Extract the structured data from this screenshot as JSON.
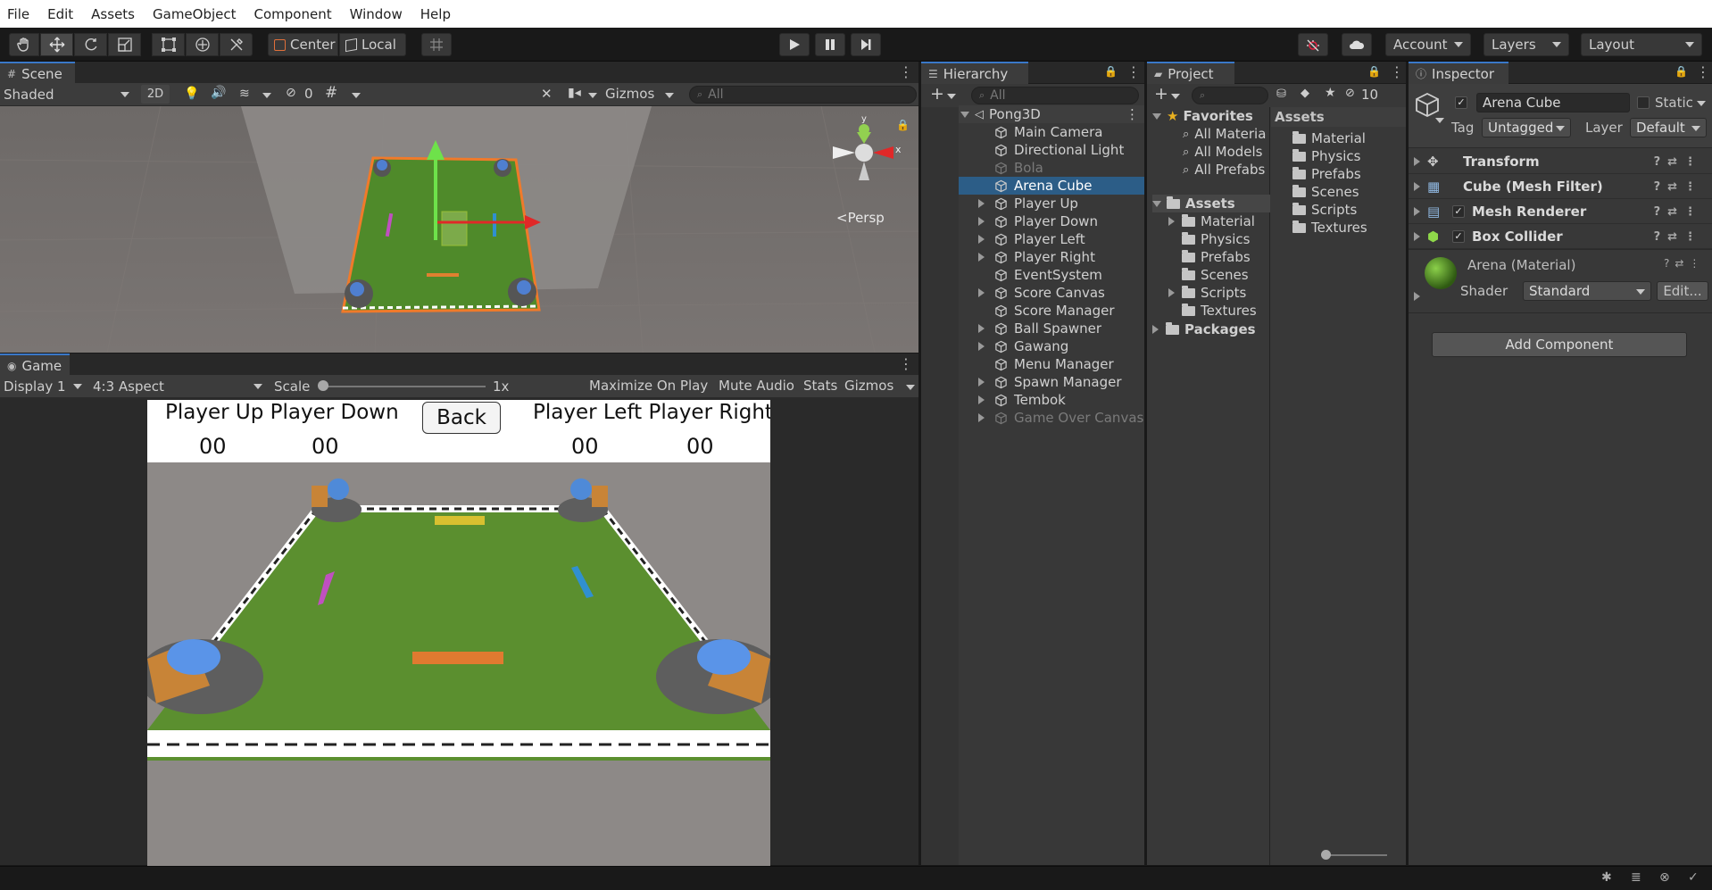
{
  "menubar": [
    "File",
    "Edit",
    "Assets",
    "GameObject",
    "Component",
    "Window",
    "Help"
  ],
  "toolbar": {
    "center_label": "Center",
    "local_label": "Local",
    "account_label": "Account",
    "layers_label": "Layers",
    "layout_label": "Layout"
  },
  "scene": {
    "tab_label": "Scene",
    "shading_mode": "Shaded",
    "btn_2d": "2D",
    "hidden_count": "0",
    "gizmos_label": "Gizmos",
    "search_placeholder": "All",
    "persp_label": "<Persp",
    "axis_y": "y",
    "axis_x": "x"
  },
  "game": {
    "tab_label": "Game",
    "display_label": "Display 1",
    "aspect_label": "4:3 Aspect",
    "scale_label": "Scale",
    "scale_value": "1x",
    "maximize_label": "Maximize On Play",
    "mute_label": "Mute Audio",
    "stats_label": "Stats",
    "gizmos_label": "Gizmos",
    "hud": {
      "player_up_down": "Player Up Player Down",
      "back_button": "Back",
      "player_left_right": "Player Left Player Right",
      "score_up": "00",
      "score_down": "00",
      "score_left": "00",
      "score_right": "00"
    }
  },
  "hierarchy": {
    "tab_label": "Hierarchy",
    "search_placeholder": "All",
    "scene_name": "Pong3D",
    "items": [
      {
        "label": "Main Camera",
        "expandable": false,
        "disabled": false,
        "selected": false
      },
      {
        "label": "Directional Light",
        "expandable": false,
        "disabled": false,
        "selected": false
      },
      {
        "label": "Bola",
        "expandable": false,
        "disabled": true,
        "selected": false
      },
      {
        "label": "Arena Cube",
        "expandable": false,
        "disabled": false,
        "selected": true
      },
      {
        "label": "Player Up",
        "expandable": true,
        "disabled": false,
        "selected": false
      },
      {
        "label": "Player Down",
        "expandable": true,
        "disabled": false,
        "selected": false
      },
      {
        "label": "Player Left",
        "expandable": true,
        "disabled": false,
        "selected": false
      },
      {
        "label": "Player Right",
        "expandable": true,
        "disabled": false,
        "selected": false
      },
      {
        "label": "EventSystem",
        "expandable": false,
        "disabled": false,
        "selected": false
      },
      {
        "label": "Score Canvas",
        "expandable": true,
        "disabled": false,
        "selected": false
      },
      {
        "label": "Score Manager",
        "expandable": false,
        "disabled": false,
        "selected": false
      },
      {
        "label": "Ball Spawner",
        "expandable": true,
        "disabled": false,
        "selected": false
      },
      {
        "label": "Gawang",
        "expandable": true,
        "disabled": false,
        "selected": false
      },
      {
        "label": "Menu Manager",
        "expandable": false,
        "disabled": false,
        "selected": false
      },
      {
        "label": "Spawn Manager",
        "expandable": true,
        "disabled": false,
        "selected": false
      },
      {
        "label": "Tembok",
        "expandable": true,
        "disabled": false,
        "selected": false
      },
      {
        "label": "Game Over Canvas",
        "expandable": true,
        "disabled": true,
        "selected": false
      }
    ]
  },
  "project": {
    "tab_label": "Project",
    "hidden_count": "10",
    "favorites_label": "Favorites",
    "favorites": [
      "All Materia",
      "All Models",
      "All Prefabs"
    ],
    "assets_label": "Assets",
    "asset_folders": [
      {
        "label": "Material",
        "expandable": true
      },
      {
        "label": "Physics",
        "expandable": false
      },
      {
        "label": "Prefabs",
        "expandable": false
      },
      {
        "label": "Scenes",
        "expandable": false
      },
      {
        "label": "Scripts",
        "expandable": true
      },
      {
        "label": "Textures",
        "expandable": false
      }
    ],
    "packages_label": "Packages",
    "content_header": "Assets",
    "content_folders": [
      "Material",
      "Physics",
      "Prefabs",
      "Scenes",
      "Scripts",
      "Textures"
    ]
  },
  "inspector": {
    "tab_label": "Inspector",
    "object_name": "Arena Cube",
    "static_label": "Static",
    "tag_label": "Tag",
    "tag_value": "Untagged",
    "layer_label": "Layer",
    "layer_value": "Default",
    "components": [
      {
        "label": "Transform",
        "checkbox": false,
        "icon": "transform-icon"
      },
      {
        "label": "Cube (Mesh Filter)",
        "checkbox": false,
        "icon": "mesh-filter-icon"
      },
      {
        "label": "Mesh Renderer",
        "checkbox": true,
        "icon": "mesh-renderer-icon"
      },
      {
        "label": "Box Collider",
        "checkbox": true,
        "icon": "box-collider-icon"
      }
    ],
    "material_name": "Arena (Material)",
    "shader_label": "Shader",
    "shader_value": "Standard",
    "edit_label": "Edit...",
    "add_component_label": "Add Component"
  },
  "colors": {
    "selection": "#2c5d87",
    "tab_accent": "#3a78c8",
    "arena_green": "#5b8f2f",
    "handle_orange": "#f07a2a"
  }
}
